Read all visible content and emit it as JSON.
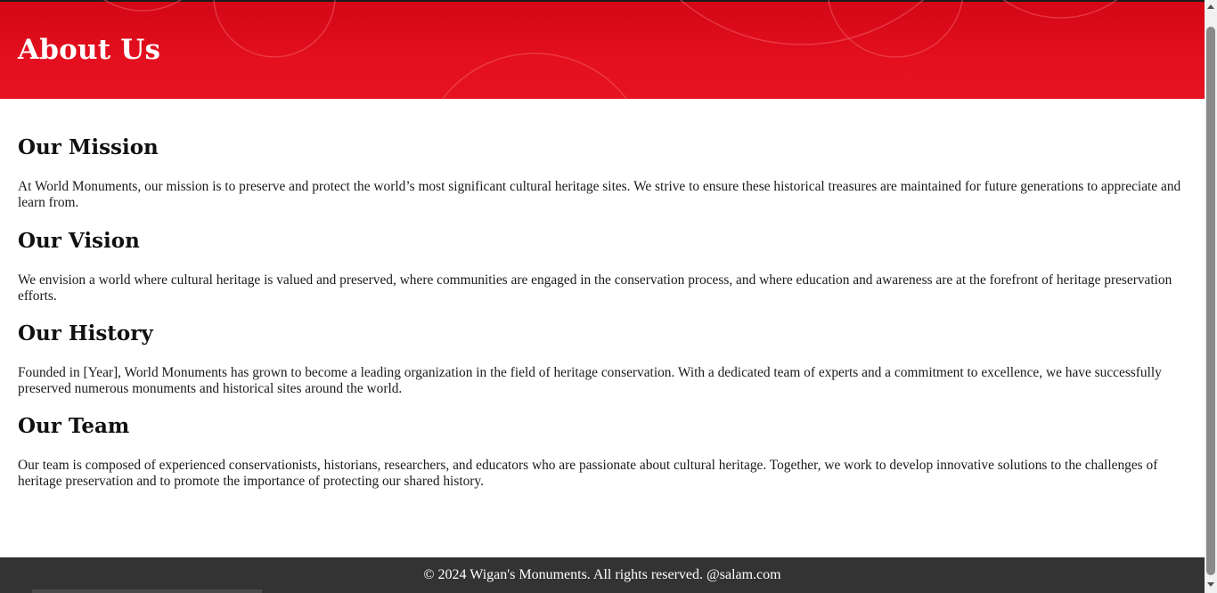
{
  "header": {
    "title": "About Us",
    "background_color": "#e10d1d"
  },
  "sections": [
    {
      "heading": "Our Mission",
      "text": "At World Monuments, our mission is to preserve and protect the world’s most significant cultural heritage sites. We strive to ensure these historical treasures are maintained for future generations to appreciate and learn from."
    },
    {
      "heading": "Our Vision",
      "text": "We envision a world where cultural heritage is valued and preserved, where communities are engaged in the conservation process, and where education and awareness are at the forefront of heritage preservation efforts."
    },
    {
      "heading": "Our History",
      "text": "Founded in [Year], World Monuments has grown to become a leading organization in the field of heritage conservation. With a dedicated team of experts and a commitment to excellence, we have successfully preserved numerous monuments and historical sites around the world."
    },
    {
      "heading": "Our Team",
      "text": "Our team is composed of experienced conservationists, historians, researchers, and educators who are passionate about cultural heritage. Together, we work to develop innovative solutions to the challenges of heritage preservation and to promote the importance of protecting our shared history."
    }
  ],
  "footer": {
    "text": "© 2024 Wigan's Monuments. All rights reserved. @salam.com",
    "background_color": "#333333"
  },
  "scrollbar": {
    "up_icon": "scroll-up-arrow",
    "down_icon": "scroll-down-arrow"
  }
}
